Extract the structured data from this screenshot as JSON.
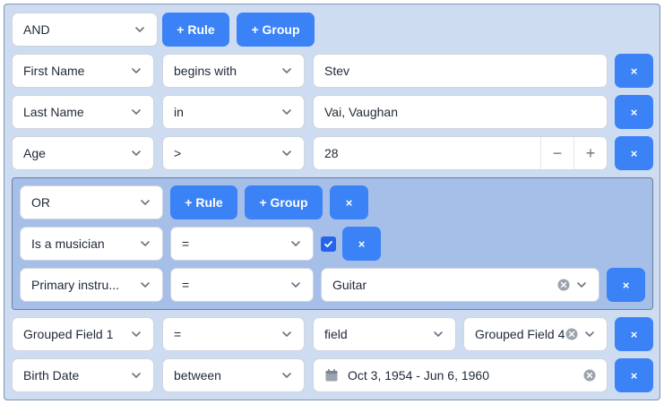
{
  "root": {
    "combinator": "AND",
    "add_rule": "+ Rule",
    "add_group": "+ Group"
  },
  "rules": [
    {
      "field": "First Name",
      "operator": "begins with",
      "value": "Stev"
    },
    {
      "field": "Last Name",
      "operator": "in",
      "value": "Vai, Vaughan"
    },
    {
      "field": "Age",
      "operator": ">",
      "value": "28",
      "decrement": "−",
      "increment": "+"
    }
  ],
  "group": {
    "combinator": "OR",
    "add_rule": "+ Rule",
    "add_group": "+ Group",
    "rules": [
      {
        "field": "Is a musician",
        "operator": "=",
        "checked": true
      },
      {
        "field": "Primary instru...",
        "operator": "=",
        "value": "Guitar"
      }
    ]
  },
  "rules_after": [
    {
      "field": "Grouped Field 1",
      "operator": "=",
      "value_source": "field",
      "value": "Grouped Field 4"
    },
    {
      "field": "Birth Date",
      "operator": "between",
      "value": "Oct 3, 1954 - Jun 6, 1960"
    }
  ],
  "remove_label": "×",
  "colors": {
    "outer_bg": "#cedcf2",
    "group_bg": "#a5bfe8",
    "button_blue": "#3b82f6",
    "checkbox_blue": "#2563eb"
  }
}
